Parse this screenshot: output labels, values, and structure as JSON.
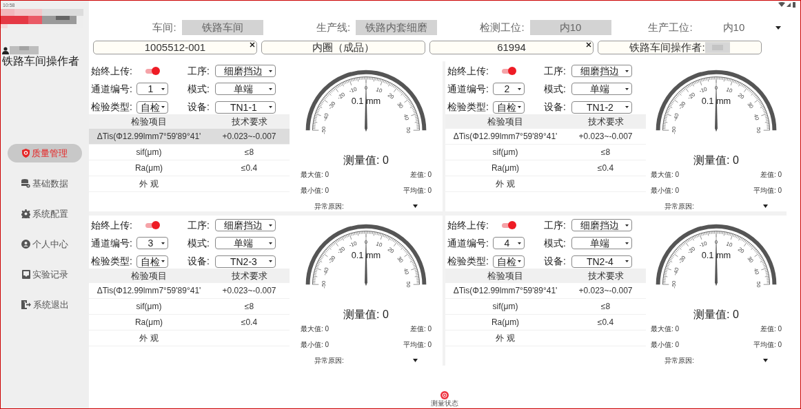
{
  "status_bar": {
    "time": "10:58"
  },
  "sidebar": {
    "role": "铁路车间操作者",
    "items": [
      {
        "label": "质量管理",
        "selected": true
      },
      {
        "label": "基础数据",
        "selected": false
      },
      {
        "label": "系统配置",
        "selected": false
      },
      {
        "label": "个人中心",
        "selected": false
      },
      {
        "label": "实验记录",
        "selected": false
      },
      {
        "label": "系统退出",
        "selected": false
      }
    ]
  },
  "header": {
    "fields": [
      {
        "label": "车间:",
        "value": "铁路车间",
        "kind": "box"
      },
      {
        "label": "生产线:",
        "value": "铁路内套细磨",
        "kind": "box"
      },
      {
        "label": "检测工位:",
        "value": "内10",
        "kind": "box"
      },
      {
        "label": "生产工位:",
        "value": "内10",
        "kind": "dropdown"
      }
    ],
    "inputs": [
      {
        "value": "1005512-001",
        "clearable": true,
        "redacted": false
      },
      {
        "value": "内圈（成品）",
        "clearable": false,
        "redacted": false
      },
      {
        "value": "61994",
        "clearable": true,
        "redacted": false
      },
      {
        "value": "铁路车间操作者:",
        "clearable": false,
        "redacted": true
      }
    ]
  },
  "panels": [
    {
      "controls": [
        {
          "kind": "toggle",
          "label": "始终上传:",
          "on": true
        },
        {
          "kind": "select",
          "label": "工序:",
          "value": "细磨挡边"
        },
        {
          "kind": "select",
          "label": "通道编号:",
          "value": "1"
        },
        {
          "kind": "select",
          "label": "模式:",
          "value": "单端"
        },
        {
          "kind": "select",
          "label": "检验类型:",
          "value": "自检"
        },
        {
          "kind": "select",
          "label": "设备:",
          "value": "TN1-1"
        }
      ],
      "table": {
        "columns": [
          "检验项目",
          "技术要求"
        ],
        "rows": [
          {
            "item": "ΔTis(Φ12.99lmm7°59'89°41'",
            "requirement": "+0.023~-0.007",
            "selected": true
          },
          {
            "item": "sif(μm)",
            "requirement": "≤8",
            "selected": false
          },
          {
            "item": "Ra(μm)",
            "requirement": "≤0.4",
            "selected": false
          },
          {
            "item": "外 观",
            "requirement": "",
            "selected": false
          }
        ]
      },
      "gauge": {
        "unit": "0.1 mm",
        "scale_labels": [
          "-50",
          "-40",
          "-30",
          "-20",
          "-10",
          "0",
          "10",
          "20",
          "30",
          "40",
          "50"
        ],
        "reading": "测量值: 0",
        "stats": [
          {
            "label": "最大值:",
            "value": "0"
          },
          {
            "label": "差值:",
            "value": "0"
          },
          {
            "label": "最小值:",
            "value": "0"
          },
          {
            "label": "平均值:",
            "value": "0"
          }
        ],
        "reason_label": "异常原因:"
      }
    },
    {
      "controls": [
        {
          "kind": "toggle",
          "label": "始终上传:",
          "on": true
        },
        {
          "kind": "select",
          "label": "工序:",
          "value": "细磨挡边"
        },
        {
          "kind": "select",
          "label": "通道编号:",
          "value": "2"
        },
        {
          "kind": "select",
          "label": "模式:",
          "value": "单端"
        },
        {
          "kind": "select",
          "label": "检验类型:",
          "value": "自检"
        },
        {
          "kind": "select",
          "label": "设备:",
          "value": "TN1-2"
        }
      ],
      "table": {
        "columns": [
          "检验项目",
          "技术要求"
        ],
        "rows": [
          {
            "item": "ΔTis(Φ12.99lmm7°59'89°41'",
            "requirement": "+0.023~-0.007",
            "selected": false
          },
          {
            "item": "sif(μm)",
            "requirement": "≤8",
            "selected": false
          },
          {
            "item": "Ra(μm)",
            "requirement": "≤0.4",
            "selected": false
          },
          {
            "item": "外 观",
            "requirement": "",
            "selected": false
          }
        ]
      },
      "gauge": {
        "unit": "0.1 mm",
        "scale_labels": [
          "-50",
          "-40",
          "-30",
          "-20",
          "-10",
          "0",
          "10",
          "20",
          "30",
          "40",
          "50"
        ],
        "reading": "测量值: 0",
        "stats": [
          {
            "label": "最大值:",
            "value": "0"
          },
          {
            "label": "差值:",
            "value": "0"
          },
          {
            "label": "最小值:",
            "value": "0"
          },
          {
            "label": "平均值:",
            "value": "0"
          }
        ],
        "reason_label": "异常原因:"
      }
    },
    {
      "controls": [
        {
          "kind": "toggle",
          "label": "始终上传:",
          "on": true
        },
        {
          "kind": "select",
          "label": "工序:",
          "value": "细磨挡边"
        },
        {
          "kind": "select",
          "label": "通道编号:",
          "value": "3"
        },
        {
          "kind": "select",
          "label": "模式:",
          "value": "单端"
        },
        {
          "kind": "select",
          "label": "检验类型:",
          "value": "自检"
        },
        {
          "kind": "select",
          "label": "设备:",
          "value": "TN2-3"
        }
      ],
      "table": {
        "columns": [
          "检验项目",
          "技术要求"
        ],
        "rows": [
          {
            "item": "ΔTis(Φ12.99lmm7°59'89°41'",
            "requirement": "+0.023~-0.007",
            "selected": false
          },
          {
            "item": "sif(μm)",
            "requirement": "≤8",
            "selected": false
          },
          {
            "item": "Ra(μm)",
            "requirement": "≤0.4",
            "selected": false
          },
          {
            "item": "外 观",
            "requirement": "",
            "selected": false
          }
        ]
      },
      "gauge": {
        "unit": "0.1 mm",
        "scale_labels": [
          "-50",
          "-40",
          "-30",
          "-20",
          "-10",
          "0",
          "10",
          "20",
          "30",
          "40",
          "50"
        ],
        "reading": "测量值: 0",
        "stats": [
          {
            "label": "最大值:",
            "value": "0"
          },
          {
            "label": "差值:",
            "value": "0"
          },
          {
            "label": "最小值:",
            "value": "0"
          },
          {
            "label": "平均值:",
            "value": "0"
          }
        ],
        "reason_label": "异常原因:"
      }
    },
    {
      "controls": [
        {
          "kind": "toggle",
          "label": "始终上传:",
          "on": true
        },
        {
          "kind": "select",
          "label": "工序:",
          "value": "细磨挡边"
        },
        {
          "kind": "select",
          "label": "通道编号:",
          "value": "4"
        },
        {
          "kind": "select",
          "label": "模式:",
          "value": "单端"
        },
        {
          "kind": "select",
          "label": "检验类型:",
          "value": "自检"
        },
        {
          "kind": "select",
          "label": "设备:",
          "value": "TN2-4"
        }
      ],
      "table": {
        "columns": [
          "检验项目",
          "技术要求"
        ],
        "rows": [
          {
            "item": "ΔTis(Φ12.99lmm7°59'89°41'",
            "requirement": "+0.023~-0.007",
            "selected": false
          },
          {
            "item": "sif(μm)",
            "requirement": "≤8",
            "selected": false
          },
          {
            "item": "Ra(μm)",
            "requirement": "≤0.4",
            "selected": false
          },
          {
            "item": "外 观",
            "requirement": "",
            "selected": false
          }
        ]
      },
      "gauge": {
        "unit": "0.1 mm",
        "scale_labels": [
          "-50",
          "-40",
          "-30",
          "-20",
          "-10",
          "0",
          "10",
          "20",
          "30",
          "40",
          "50"
        ],
        "reading": "测量值: 0",
        "stats": [
          {
            "label": "最大值:",
            "value": "0"
          },
          {
            "label": "差值:",
            "value": "0"
          },
          {
            "label": "最小值:",
            "value": "0"
          },
          {
            "label": "平均值:",
            "value": "0"
          }
        ],
        "reason_label": "异常原因:"
      }
    }
  ],
  "bottom_nav": {
    "label": "测量状态"
  }
}
